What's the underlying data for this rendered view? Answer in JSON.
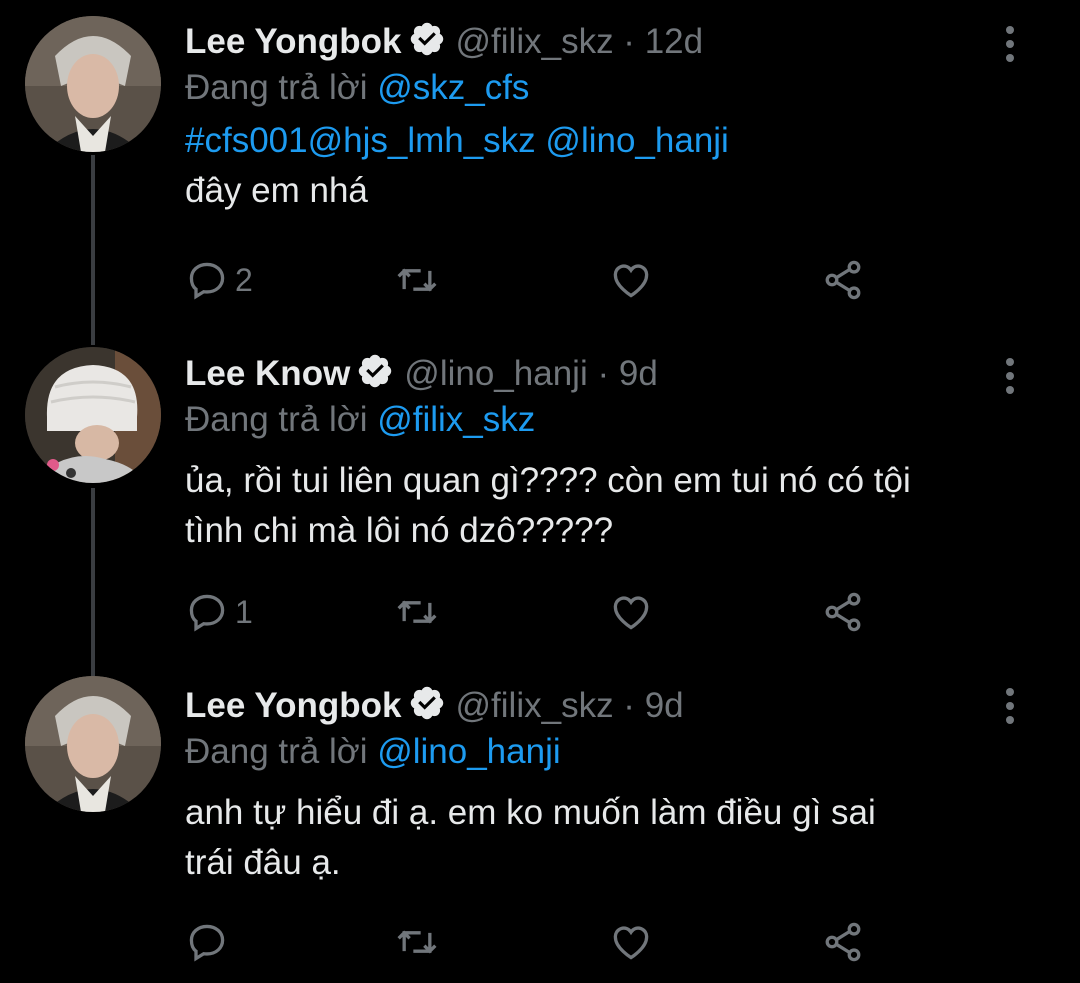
{
  "tweets": [
    {
      "name": "Lee Yongbok",
      "handle": "@filix_skz",
      "separator": "·",
      "time": "12d",
      "reply_prefix": "Đang trả lời",
      "reply_to": "@skz_cfs",
      "link_line": "#cfs001@hjs_lmh_skz @lino_hanji",
      "text": "đây em nhá",
      "reply_count": "2",
      "avatar": "avatar-lee-yongbok"
    },
    {
      "name": "Lee Know",
      "handle": "@lino_hanji",
      "separator": "·",
      "time": "9d",
      "reply_prefix": "Đang trả lời",
      "reply_to": "@filix_skz",
      "text_line1": "ủa, rồi tui liên quan gì???? còn em tui nó có tội",
      "text_line2": "tình chi mà lôi nó dzô?????",
      "reply_count": "1",
      "avatar": "avatar-lee-know"
    },
    {
      "name": "Lee Yongbok",
      "handle": "@filix_skz",
      "separator": "·",
      "time": "9d",
      "reply_prefix": "Đang trả lời",
      "reply_to": "@lino_hanji",
      "text_line1": "anh tự hiểu đi ạ. em ko muốn làm điều gì sai",
      "text_line2": "trái đâu ạ.",
      "reply_count": "",
      "avatar": "avatar-lee-yongbok"
    }
  ],
  "icons": {
    "reply": "reply-icon",
    "retweet": "retweet-icon",
    "like": "heart-icon",
    "share": "share-icon",
    "more": "more-options-icon",
    "verified": "verified-badge-icon"
  },
  "colors": {
    "background": "#000000",
    "text": "#e7e9ea",
    "secondary": "#71767b",
    "link": "#1d9bf0",
    "thread_line": "#3a3d41"
  }
}
